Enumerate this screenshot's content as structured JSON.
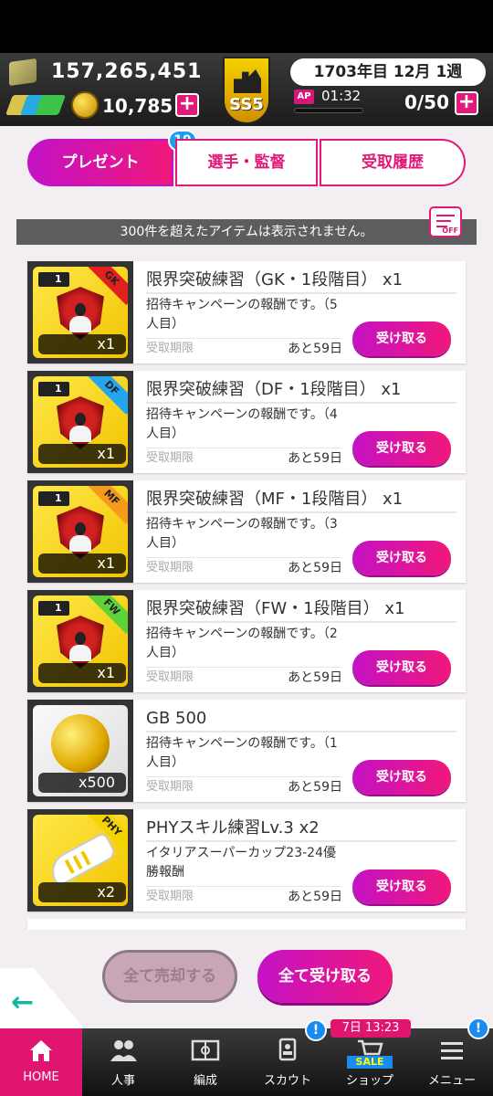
{
  "header": {
    "money": "157,265,451",
    "gb": "10,785",
    "date": "1703年目 12月 1週",
    "ap_label": "AP",
    "ap_time": "01:32",
    "ap_count": "0/50",
    "logo_text": "SS5",
    "plus": "+"
  },
  "tabs": [
    {
      "label": "プレゼント",
      "badge": "19",
      "active": true
    },
    {
      "label": "選手・監督",
      "active": false
    },
    {
      "label": "受取履歴",
      "active": false
    }
  ],
  "notice": "300件を超えたアイテムは表示されません。",
  "filter": {
    "off_label": "OFF"
  },
  "items": [
    {
      "title": "限界突破練習（GK・1段階目） x1",
      "desc": "招待キャンペーンの報酬です。（5人目）",
      "rank": "1",
      "corner": "GK",
      "corner_color": "#e32020",
      "qty": "x1",
      "expiry_label": "受取期限",
      "expiry": "あと59日",
      "button": "受け取る"
    },
    {
      "title": "限界突破練習（DF・1段階目） x1",
      "desc": "招待キャンペーンの報酬です。（4人目）",
      "rank": "1",
      "corner": "DF",
      "corner_color": "#21a6ef",
      "qty": "x1",
      "expiry_label": "受取期限",
      "expiry": "あと59日",
      "button": "受け取る"
    },
    {
      "title": "限界突破練習（MF・1段階目） x1",
      "desc": "招待キャンペーンの報酬です。（3人目）",
      "rank": "1",
      "corner": "MF",
      "corner_color": "#f59a1b",
      "qty": "x1",
      "expiry_label": "受取期限",
      "expiry": "あと59日",
      "button": "受け取る"
    },
    {
      "title": "限界突破練習（FW・1段階目） x1",
      "desc": "招待キャンペーンの報酬です。（2人目）",
      "rank": "1",
      "corner": "FW",
      "corner_color": "#5fd23a",
      "qty": "x1",
      "expiry_label": "受取期限",
      "expiry": "あと59日",
      "button": "受け取る"
    },
    {
      "title": "GB 500",
      "desc": "招待キャンペーンの報酬です。（1人目）",
      "qty": "x500",
      "expiry_label": "受取期限",
      "expiry": "あと59日",
      "button": "受け取る"
    },
    {
      "title": "PHYスキル練習Lv.3 x2",
      "desc": "イタリアスーパーカップ23-24優勝報酬",
      "corner": "PHY",
      "corner_color": "#f3d400",
      "qty": "x2",
      "expiry_label": "受取期限",
      "expiry": "あと59日",
      "button": "受け取る"
    }
  ],
  "actions": {
    "sell_all": "全て売却する",
    "receive_all": "全て受け取る",
    "back": "←"
  },
  "nav": [
    {
      "label": "HOME",
      "icon": "home-icon",
      "active": true
    },
    {
      "label": "人事",
      "icon": "people-icon"
    },
    {
      "label": "編成",
      "icon": "pitch-icon"
    },
    {
      "label": "スカウト",
      "icon": "scout-icon",
      "bang": "!"
    },
    {
      "label": "ショップ",
      "icon": "cart-icon",
      "timer": "7日 13:23",
      "sale": "SALE"
    },
    {
      "label": "メニュー",
      "icon": "menu-icon",
      "bang": "!"
    }
  ],
  "colors": {
    "accent": "#e11a7a",
    "accent2": "#c412c6",
    "badge_blue": "#1aa0f0"
  }
}
